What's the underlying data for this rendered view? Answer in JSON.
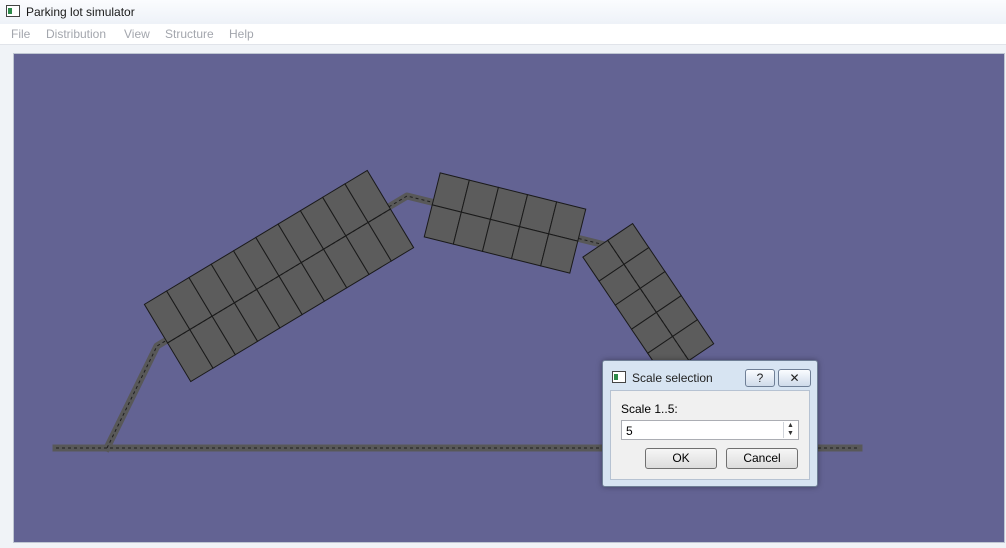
{
  "window": {
    "title": "Parking lot simulator",
    "icon": "app-window-icon"
  },
  "menu": [
    {
      "label": "File"
    },
    {
      "label": "Distribution"
    },
    {
      "label": "View"
    },
    {
      "label": "Structure"
    },
    {
      "label": "Help"
    }
  ],
  "scene": {
    "background": "#636393",
    "road_color": "#585858",
    "spot_color": "#5c5c5c"
  },
  "dialog": {
    "title": "Scale selection",
    "help_label": "?",
    "close_label": "✕",
    "prompt": "Scale 1..5:",
    "value": "5",
    "ok_label": "OK",
    "cancel_label": "Cancel"
  }
}
